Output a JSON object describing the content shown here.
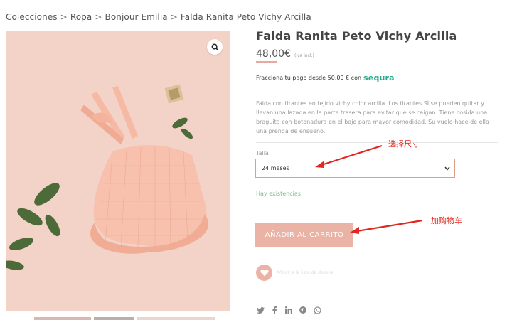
{
  "breadcrumb": {
    "items": [
      "Colecciones",
      "Ropa",
      "Bonjour Emilia",
      "Falda Ranita Peto Vichy Arcilla"
    ],
    "separator": ">"
  },
  "product": {
    "title": "Falda Ranita Peto Vichy Arcilla",
    "price": "48,00€",
    "price_note": "(iva incl.)",
    "finance_text": "Fracciona tu pago desde 50,00 € con",
    "finance_brand": "sequra",
    "description": "Falda con tirantes en tejido vichy color arcilla. Los tirantes SÍ se pueden quitar y llevan una lazada en la parte trasera para evitar que se caigan. Tiene cosida una braguita con botonadura en el bajo para mayor comodidad. Su vuelo hace de ella una prenda de ensueño.",
    "size_label": "Talla",
    "size_selected": "24 meses",
    "stock": "Hay existencias",
    "add_to_cart": "AÑADIR AL CARRITO",
    "wishlist_text": "Añadir a la lista de deseos"
  },
  "annotations": {
    "select_size": "选择尺寸",
    "add_to_cart": "加购物车"
  },
  "colors": {
    "accent": "#ebb3a6",
    "annotation": "#e0281f",
    "sequra": "#26a88a",
    "stock": "#7fb58c"
  },
  "icons": {
    "zoom": "magnifier-icon",
    "select": "chevron-down-icon",
    "wishlist": "heart-icon",
    "share": [
      "twitter-icon",
      "facebook-icon",
      "linkedin-icon",
      "pinterest-icon",
      "whatsapp-icon"
    ]
  }
}
